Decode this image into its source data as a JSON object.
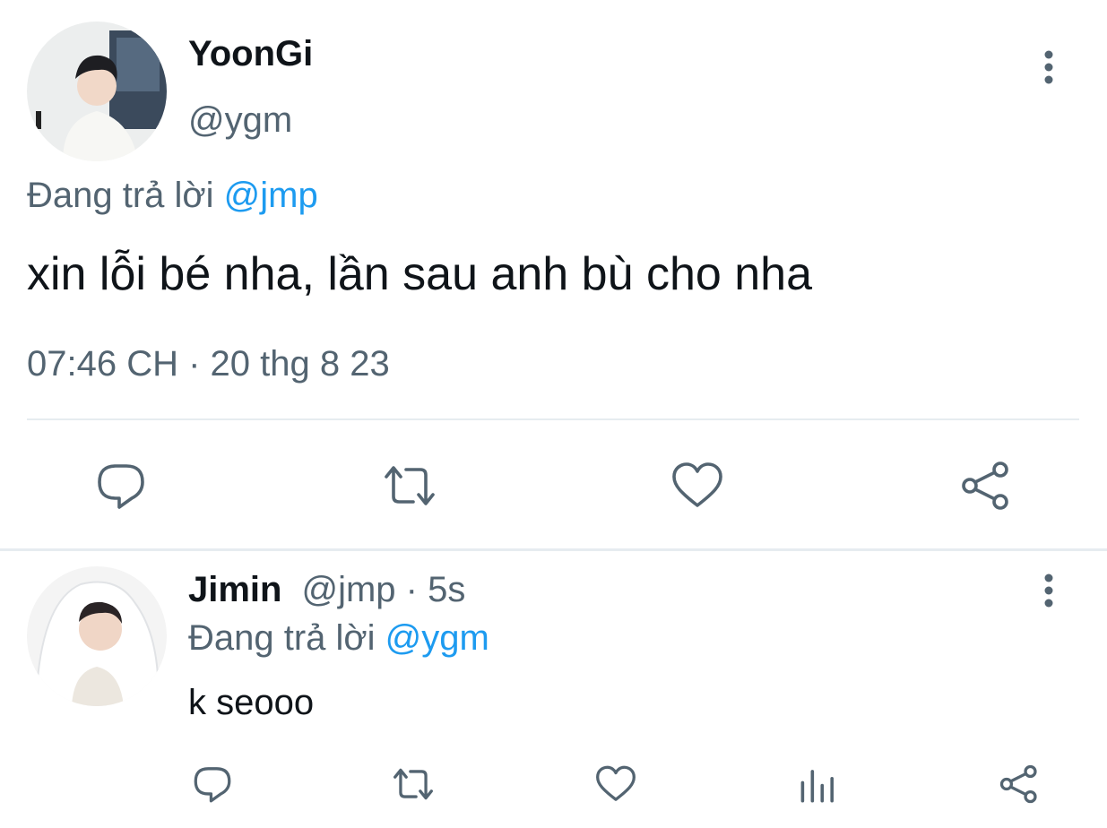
{
  "main_tweet": {
    "author_name": "YoonGi",
    "author_handle": "@ygm",
    "reply_prefix": "Đang trả lời ",
    "reply_to": "@jmp",
    "text": "xin lỗi bé nha, lần sau anh bù cho nha",
    "timestamp": "07:46 CH · 20 thg 8 23",
    "actions": [
      {
        "icon": "reply-icon"
      },
      {
        "icon": "retweet-icon"
      },
      {
        "icon": "like-icon"
      },
      {
        "icon": "share-icon"
      }
    ]
  },
  "reply_tweet": {
    "author_name": "Jimin",
    "author_handle": "@jmp",
    "separator": " · ",
    "time_ago": "5s",
    "reply_prefix": "Đang trả lời ",
    "reply_to": "@ygm",
    "text": "k seooo",
    "actions": [
      {
        "icon": "reply-icon"
      },
      {
        "icon": "retweet-icon"
      },
      {
        "icon": "like-icon"
      },
      {
        "icon": "analytics-icon"
      },
      {
        "icon": "share-icon"
      }
    ]
  },
  "colors": {
    "text_primary": "#0f1419",
    "text_secondary": "#536471",
    "accent": "#1d9bf0",
    "divider": "#e6ecf0"
  }
}
